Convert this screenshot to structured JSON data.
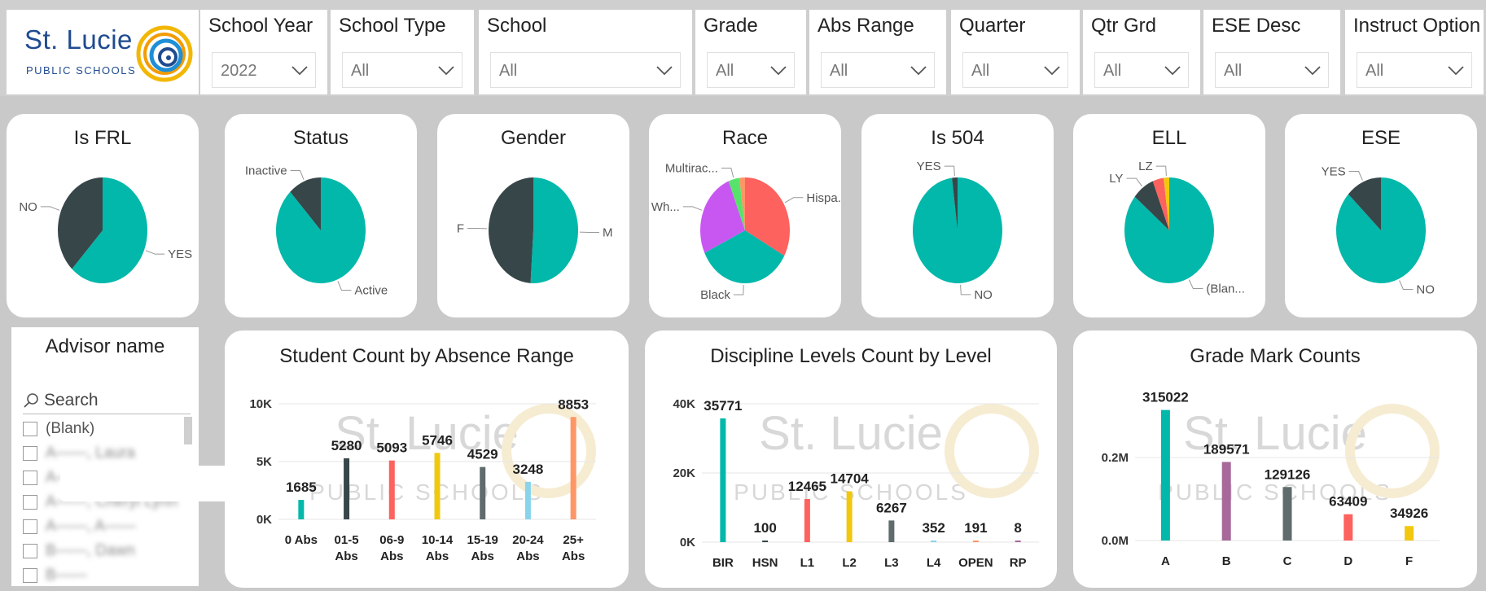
{
  "logo": {
    "name": "St. Lucie",
    "sub": "PUBLIC SCHOOLS"
  },
  "colors": {
    "teal": "#01b8aa",
    "dark": "#374649",
    "red": "#fd625e",
    "yellow": "#f2c80f",
    "gray": "#5f6b6d",
    "lightblue": "#8ad4eb",
    "orange": "#fe9666",
    "purple": "#a66999",
    "violet": "#c857f2",
    "green": "#57e36b"
  },
  "filters": [
    {
      "title": "School Year",
      "value": "2022"
    },
    {
      "title": "School Type",
      "value": "All"
    },
    {
      "title": "School",
      "value": "All"
    },
    {
      "title": "Grade",
      "value": "All"
    },
    {
      "title": "Abs Range",
      "value": "All"
    },
    {
      "title": "Quarter",
      "value": "All"
    },
    {
      "title": "Qtr Grd",
      "value": "All"
    },
    {
      "title": "ESE Desc",
      "value": "All"
    },
    {
      "title": "Instruct Option",
      "value": "All"
    }
  ],
  "pies": [
    {
      "title": "Is FRL",
      "slices": [
        {
          "label": "YES",
          "value": 62,
          "color": "#01b8aa"
        },
        {
          "label": "NO",
          "value": 38,
          "color": "#374649"
        }
      ]
    },
    {
      "title": "Status",
      "slices": [
        {
          "label": "Active",
          "value": 88,
          "color": "#01b8aa"
        },
        {
          "label": "Inactive",
          "value": 12,
          "color": "#374649"
        }
      ]
    },
    {
      "title": "Gender",
      "slices": [
        {
          "label": "M",
          "value": 51,
          "color": "#01b8aa"
        },
        {
          "label": "F",
          "value": 49,
          "color": "#374649"
        }
      ]
    },
    {
      "title": "Race",
      "slices": [
        {
          "label": "Hispa...",
          "value": 33,
          "color": "#fd625e"
        },
        {
          "label": "Black",
          "value": 35,
          "color": "#01b8aa"
        },
        {
          "label": "Wh...",
          "value": 26,
          "color": "#c857f2"
        },
        {
          "label": "Multirac...",
          "value": 4,
          "color": "#57e36b"
        },
        {
          "label": "",
          "value": 2,
          "color": "#fe9666"
        }
      ]
    },
    {
      "title": "Is 504",
      "slices": [
        {
          "label": "NO",
          "value": 98,
          "color": "#01b8aa"
        },
        {
          "label": "YES",
          "value": 2,
          "color": "#374649"
        }
      ]
    },
    {
      "title": "ELL",
      "slices": [
        {
          "label": "(Blan...",
          "value": 86,
          "color": "#01b8aa"
        },
        {
          "label": "LY",
          "value": 8,
          "color": "#374649"
        },
        {
          "label": "",
          "value": 4,
          "color": "#fd625e"
        },
        {
          "label": "LZ",
          "value": 2,
          "color": "#f2c80f"
        }
      ]
    },
    {
      "title": "ESE",
      "slices": [
        {
          "label": "NO",
          "value": 87,
          "color": "#01b8aa"
        },
        {
          "label": "YES",
          "value": 13,
          "color": "#374649"
        }
      ]
    }
  ],
  "advisor": {
    "title": "Advisor name",
    "search_placeholder": "Search",
    "items": [
      "(Blank)",
      "A——, Laura",
      "A——, C——",
      "A——, Cheryl Lynn",
      "A——, A——",
      "B——, Dawn",
      "B——"
    ]
  },
  "chart_data": [
    {
      "type": "bar",
      "title": "Student Count by Absence Range",
      "categories": [
        "0 Abs",
        "01-5 Abs",
        "06-9 Abs",
        "10-14 Abs",
        "15-19 Abs",
        "20-24 Abs",
        "25+ Abs"
      ],
      "values": [
        1685,
        5280,
        5093,
        5746,
        4529,
        3248,
        8853
      ],
      "value_labels": [
        "1685",
        "5280",
        "5093",
        "5746",
        "4529",
        "3248",
        "8853"
      ],
      "colors": [
        "#01b8aa",
        "#374649",
        "#fd625e",
        "#f2c80f",
        "#5f6b6d",
        "#8ad4eb",
        "#fe9666"
      ],
      "ylim": [
        0,
        10000
      ],
      "yticks": [
        0,
        5000,
        10000
      ],
      "ytick_labels": [
        "0K",
        "5K",
        "10K"
      ],
      "grid": true
    },
    {
      "type": "bar",
      "title": "Discipline Levels Count by Level",
      "categories": [
        "BIR",
        "HSN",
        "L1",
        "L2",
        "L3",
        "L4",
        "OPEN",
        "RP"
      ],
      "values": [
        35771,
        100,
        12465,
        14704,
        6267,
        352,
        191,
        8
      ],
      "value_labels": [
        "35771",
        "100",
        "12465",
        "14704",
        "6267",
        "352",
        "191",
        "8"
      ],
      "colors": [
        "#01b8aa",
        "#374649",
        "#fd625e",
        "#f2c80f",
        "#5f6b6d",
        "#8ad4eb",
        "#fe9666",
        "#a66999"
      ],
      "ylim": [
        0,
        40000
      ],
      "yticks": [
        0,
        20000,
        40000
      ],
      "ytick_labels": [
        "0K",
        "20K",
        "40K"
      ],
      "grid": true
    },
    {
      "type": "bar",
      "title": "Grade Mark Counts",
      "categories": [
        "A",
        "B",
        "C",
        "D",
        "F"
      ],
      "values": [
        315022,
        189571,
        129126,
        63409,
        34926
      ],
      "value_labels": [
        "315022",
        "189571",
        "129126",
        "63409",
        "34926"
      ],
      "colors": [
        "#01b8aa",
        "#a66999",
        "#5f6b6d",
        "#fd625e",
        "#f2c80f"
      ],
      "ylim": [
        0,
        330000
      ],
      "yticks": [
        0,
        200000
      ],
      "ytick_labels": [
        "0.0M",
        "0.2M"
      ],
      "grid": true
    }
  ]
}
